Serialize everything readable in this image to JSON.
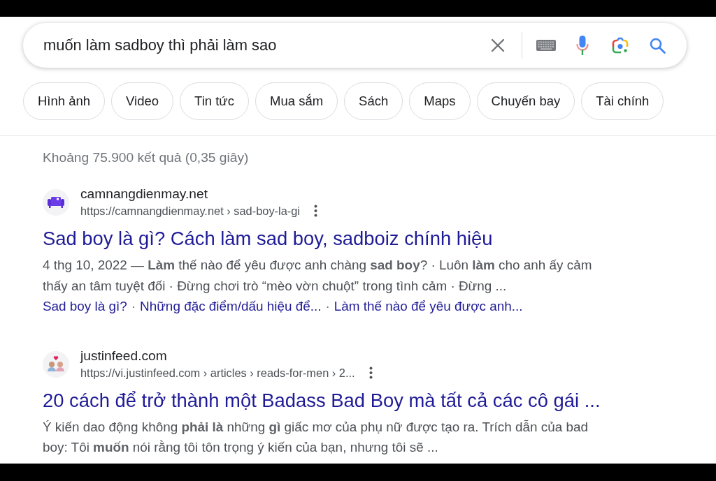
{
  "search": {
    "query": "muốn làm sadboy thì phải làm sao"
  },
  "chips": [
    "Hình ảnh",
    "Video",
    "Tin tức",
    "Mua sắm",
    "Sách",
    "Maps",
    "Chuyến bay",
    "Tài chính"
  ],
  "result_stats": "Khoảng 75.900 kết quả (0,35 giây)",
  "results": [
    {
      "site_name": "camnangdienmay.net",
      "url": "https://camnangdienmay.net › sad-boy-la-gi",
      "title": "Sad boy là gì? Cách làm sad boy, sadboiz chính hiệu",
      "snippet": "4 thg 10, 2022 — **Làm** thế nào để yêu được anh chàng **sad boy**? · Luôn **làm** cho anh ấy cảm thấy an tâm tuyệt đối · Đừng chơi trò “mèo vờn chuột” trong tình cảm · Đừng ...",
      "sitelinks": [
        "Sad boy là gì?",
        "Những đặc điểm/dấu hiệu để...",
        "Làm thế nào để yêu được anh..."
      ],
      "separator": "·"
    },
    {
      "site_name": "justinfeed.com",
      "url": "https://vi.justinfeed.com › articles › reads-for-men › 2...",
      "title": "20 cách để trở thành một Badass Bad Boy mà tất cả các cô gái ...",
      "snippet": "Ý kiến dao động không **phải là** những **gì** giấc mơ của phụ nữ được tạo ra. Trích dẫn của bad boy: Tôi **muốn** nói rằng tôi tôn trọng ý kiến của bạn, nhưng tôi sẽ ..."
    }
  ]
}
